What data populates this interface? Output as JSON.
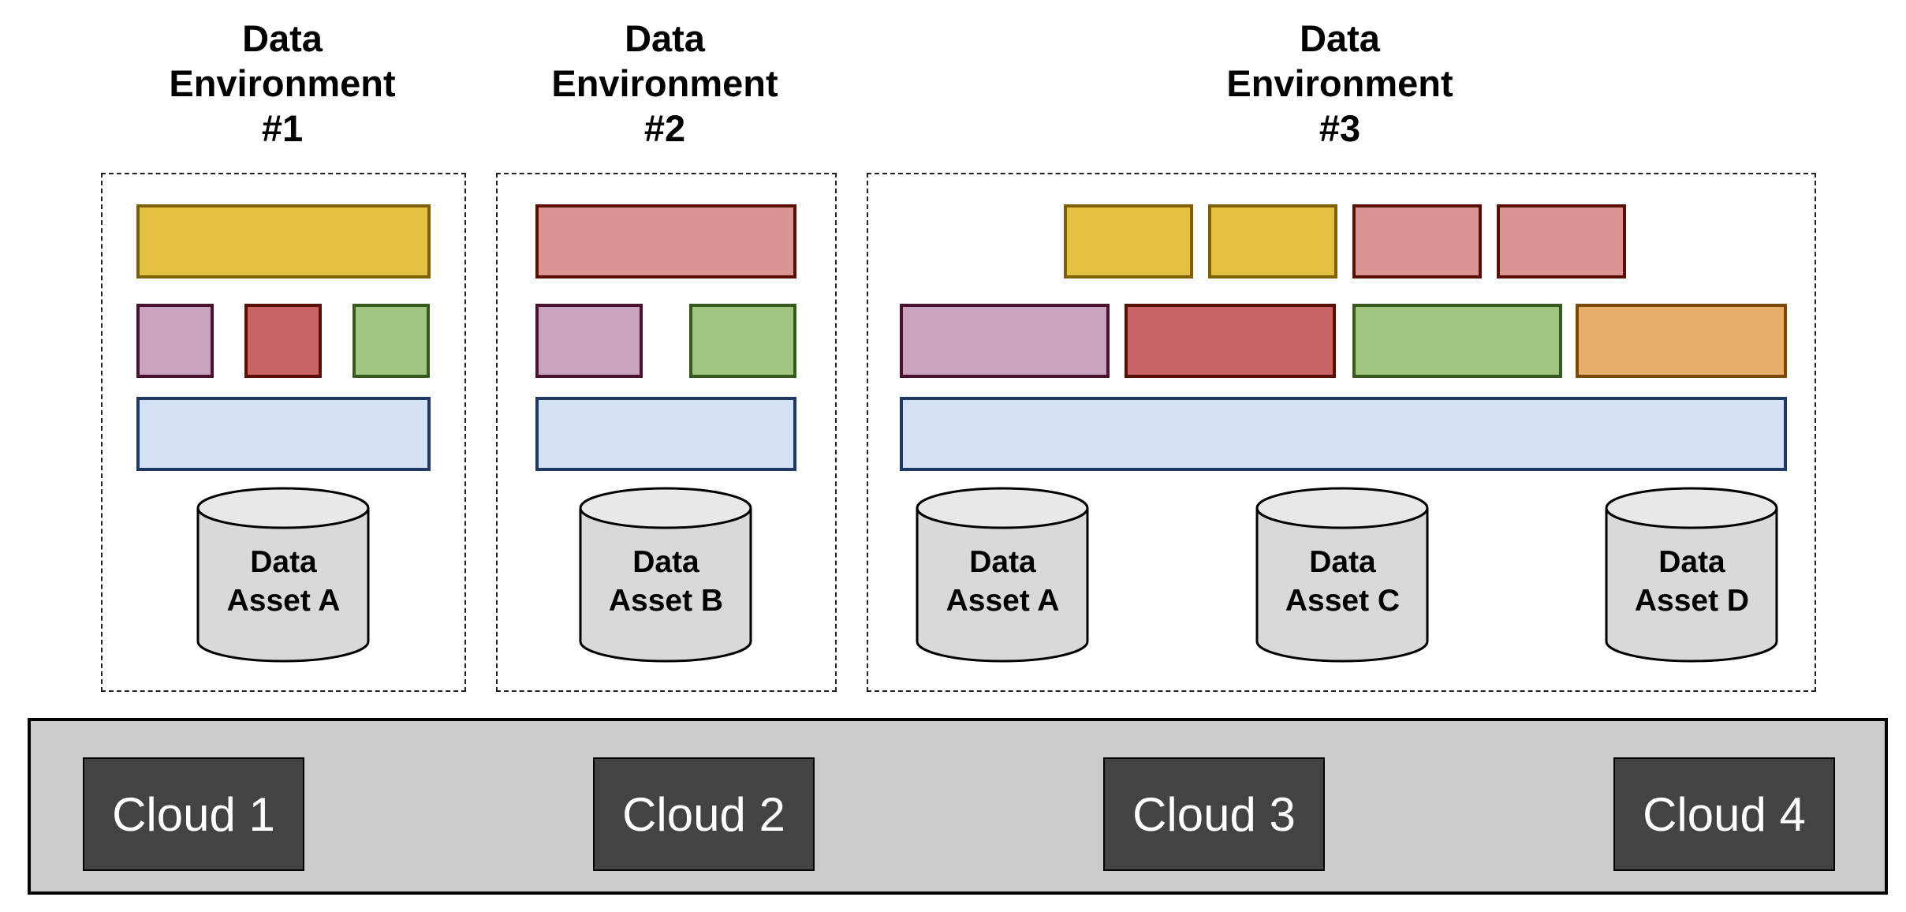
{
  "environments": [
    {
      "title": "Data\nEnvironment\n#1",
      "assets": [
        "Data\nAsset A"
      ]
    },
    {
      "title": "Data\nEnvironment\n#2",
      "assets": [
        "Data\nAsset B"
      ]
    },
    {
      "title": "Data\nEnvironment\n#3",
      "assets": [
        "Data\nAsset A",
        "Data\nAsset C",
        "Data\nAsset D"
      ]
    }
  ],
  "clouds": [
    "Cloud 1",
    "Cloud 2",
    "Cloud 3",
    "Cloud 4"
  ],
  "colors": {
    "yellow": {
      "fill": "#e3c042",
      "stroke": "#7f6000"
    },
    "pink": {
      "fill": "#d99594",
      "stroke": "#5b0f00"
    },
    "mauve": {
      "fill": "#c9a2bb",
      "stroke": "#4c1130"
    },
    "red": {
      "fill": "#c96565",
      "stroke": "#5b0f00"
    },
    "green": {
      "fill": "#9fc581",
      "stroke": "#38581c"
    },
    "orange": {
      "fill": "#e7b16d",
      "stroke": "#7f4800"
    },
    "blue": {
      "fill": "#d4e1f2",
      "stroke": "#1f3864"
    },
    "cylinder": {
      "fill": "#d9d9d9",
      "top": "#e8e8e8",
      "stroke": "#000000"
    },
    "cloud_bar": "#cbcbcb",
    "cloud_box": "#434343"
  }
}
